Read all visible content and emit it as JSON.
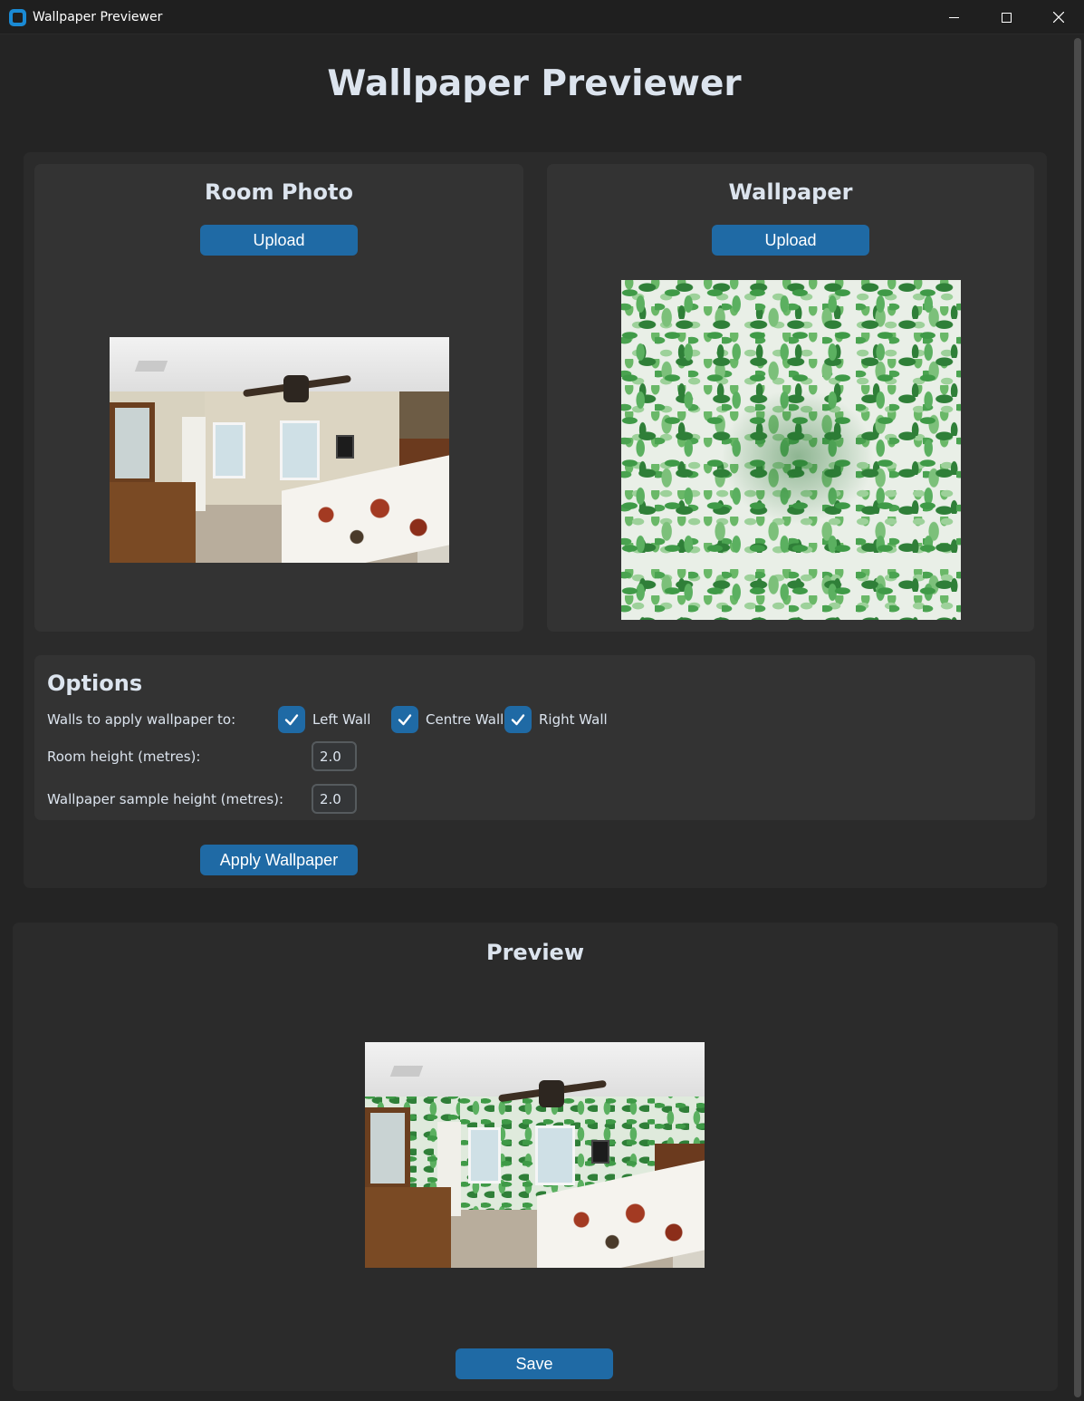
{
  "window": {
    "title": "Wallpaper Previewer"
  },
  "header": {
    "title": "Wallpaper Previewer"
  },
  "room_card": {
    "title": "Room Photo",
    "upload_label": "Upload"
  },
  "wallpaper_card": {
    "title": "Wallpaper",
    "upload_label": "Upload"
  },
  "options": {
    "title": "Options",
    "walls_label": "Walls to apply wallpaper to:",
    "walls": [
      {
        "label": "Left Wall",
        "checked": true
      },
      {
        "label": "Centre Wall",
        "checked": true
      },
      {
        "label": "Right Wall",
        "checked": true
      }
    ],
    "room_height_label": "Room height (metres):",
    "room_height_value": "2.0",
    "sample_height_label": "Wallpaper sample height (metres):",
    "sample_height_value": "2.0",
    "apply_label": "Apply Wallpaper"
  },
  "preview": {
    "title": "Preview",
    "save_label": "Save"
  },
  "colors": {
    "accent": "#1f6aa5",
    "background": "#242424",
    "panel": "#2b2b2b",
    "card": "#333333"
  },
  "icons": {
    "app": "app-icon",
    "minimize": "minimize-icon",
    "maximize": "maximize-icon",
    "close": "close-icon",
    "checkbox": "checkmark-icon"
  }
}
